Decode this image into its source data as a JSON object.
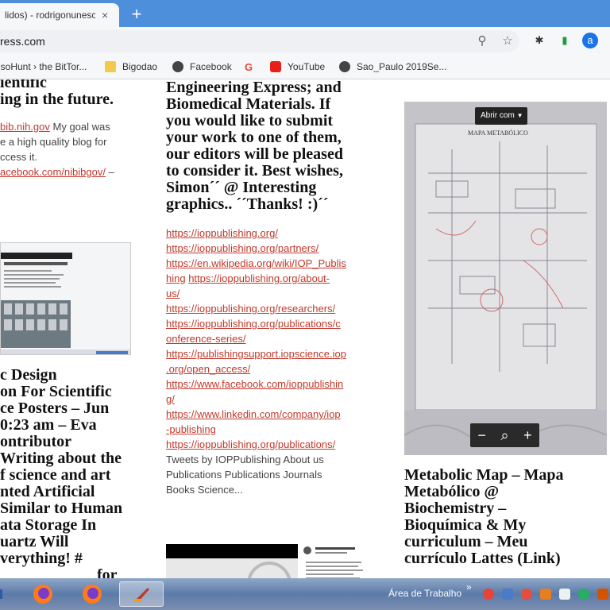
{
  "browser": {
    "tab": {
      "title": "lidos) - rodrigonunesc",
      "close_glyph": "×"
    },
    "new_tab_glyph": "+",
    "url": "ress.com",
    "bookmarks": [
      {
        "label": "isoHunt › the BitTor...",
        "icon": "isohunt-icon",
        "color": "#e74c3c"
      },
      {
        "label": "Bigodao",
        "icon": "folder-icon",
        "color": "#f2c94c"
      },
      {
        "label": "Facebook",
        "icon": "globe-icon",
        "color": "#444444"
      },
      {
        "label": "",
        "icon": "google-icon",
        "color": "#ea4335"
      },
      {
        "label": "YouTube",
        "icon": "youtube-icon",
        "color": "#e62117"
      },
      {
        "label": "Sao_Paulo 2019Se...",
        "icon": "globe-icon",
        "color": "#444444"
      }
    ]
  },
  "col1": {
    "top_title": [
      "ientific",
      "ing in the future."
    ],
    "link1": "bib.nih.gov",
    "text1": " My goal was",
    "text2": "e a high quality blog for",
    "text3": "ccess it.",
    "link2": "acebook.com/nibibgov/",
    "text4": " –",
    "article_title": [
      "c Design",
      "on For Scientific",
      "ce Posters – Jun",
      "0:23 am – Eva",
      "ontributor",
      "Writing about the",
      "f science and art",
      "nted Artificial",
      "Similar to Human",
      "ata Storage In",
      "uartz Will",
      "verything! #"
    ],
    "bottom_fragment": "for"
  },
  "col2": {
    "title_lines": [
      "Engineering Express; and",
      "Biomedical Materials. If",
      "you would like to submit",
      "your work to one of them,",
      "our editors will be pleased",
      "to consider it. Best wishes,",
      "Simon´´ @ Interesting",
      "graphics.. ´´Thanks! :)´´"
    ],
    "links": [
      "https://ioppublishing.org/",
      "https://ioppublishing.org/partners/",
      "https://en.wikipedia.org/wiki/IOP_Publis",
      "hing",
      "https://ioppublishing.org/about-",
      "us/",
      "https://ioppublishing.org/researchers/",
      "https://ioppublishing.org/publications/c",
      "onference-series/",
      "https://publishingsupport.iopscience.iop",
      ".org/open_access/",
      "https://www.facebook.com/ioppublishin",
      "g/",
      "https://www.linkedin.com/company/iop",
      "-publishing",
      "https://ioppublishing.org/publications/"
    ],
    "body": [
      "Tweets by IOPPublishing About us",
      "Publications Publications Journals",
      "Books Science..."
    ]
  },
  "col3": {
    "image_overlay_button": "Abrir com",
    "map_heading": "MAPA METABÓLICO",
    "zoom": {
      "minus": "−",
      "search": "⌕",
      "plus": "+"
    },
    "title_lines": [
      "Metabolic Map – Mapa",
      "Metabólico @",
      "Biochemistry –",
      "Bioquímica & My",
      "curriculum – Meu",
      "currículo Lattes (Link)"
    ]
  },
  "taskbar": {
    "desktop_label": "Área de Trabalho",
    "chevron": "»",
    "apps": [
      "windows-icon",
      "firefox-icon",
      "firefox-icon",
      "ccleaner-icon"
    ]
  }
}
